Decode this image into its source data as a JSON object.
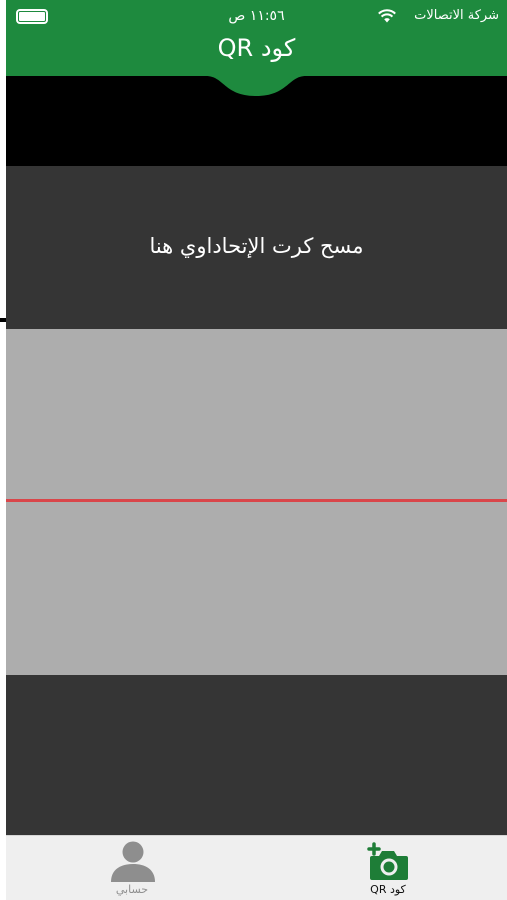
{
  "status_bar": {
    "carrier": "شركة الاتصالات",
    "time": "١١:٥٦ ص"
  },
  "header": {
    "title": "كود QR",
    "background_color": "#1e8a3e"
  },
  "scanner": {
    "instruction": "مسح كرت الإتحاداوي هنا",
    "scan_line_color": "#d9464a"
  },
  "tab_bar": {
    "tabs": [
      {
        "label": "حسابي",
        "icon": "person-icon",
        "active": false
      },
      {
        "label": "كود QR",
        "icon": "camera-add-icon",
        "active": true
      }
    ]
  }
}
